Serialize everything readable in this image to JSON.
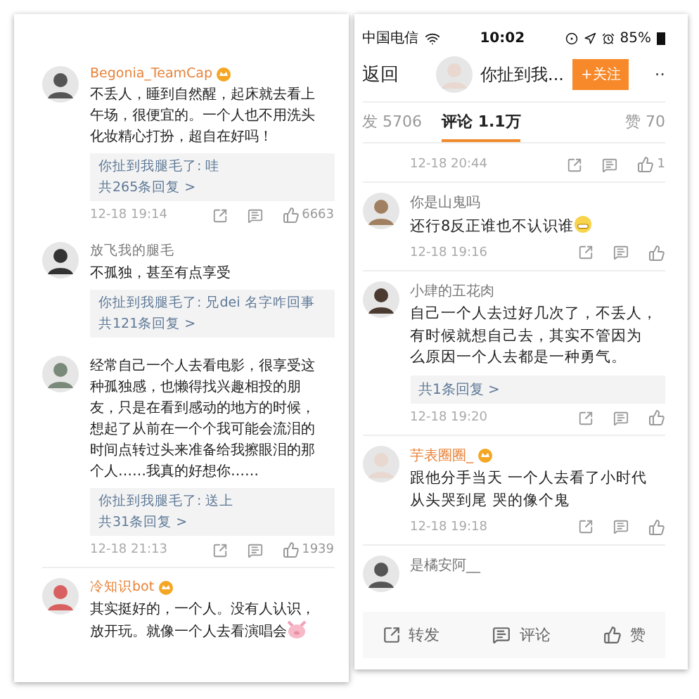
{
  "left_panel": {
    "comments": [
      {
        "kind": "comment",
        "user": "Begonia_TeamCap",
        "vip": true,
        "lines": [
          "不丢人，睡到自然醒，起床就去看上",
          "午场，很便宜的。一个人也不用洗头",
          "化妆精心打扮，超自在好吗！"
        ],
        "reply": {
          "preview": "你扯到我腿毛了: 哇",
          "count": "共265条回复 >"
        },
        "time": "12-18 19:14",
        "likes": "6663"
      },
      {
        "kind": "comment",
        "user": "放飞我的腿毛",
        "vip": false,
        "lines": [
          "不孤独，甚至有点享受"
        ],
        "reply": {
          "preview": "你扯到我腿毛了: 兄dei 名字咋回事",
          "count": "共121条回复 >"
        }
      },
      {
        "kind": "comment",
        "lines": [
          "经常自己一个人去看电影，很享受这",
          "种孤独感，也懒得找兴趣相投的朋",
          "友，只是在看到感动的地方的时候，",
          "想起了从前在一个个我可能会流泪的",
          "时间点转过头来准备给我擦眼泪的那",
          "个人……我真的好想你……"
        ],
        "reply": {
          "preview": "你扯到我腿毛了: 送上",
          "count": "共31条回复 >"
        },
        "time": "12-18 21:13",
        "likes": "1939"
      },
      {
        "kind": "comment",
        "user": "冷知识bot",
        "vip": true,
        "lines": [
          "其实挺好的，一个人。没有人认识，",
          "放开玩。就像一个人去看演唱会"
        ],
        "emoji": {
          "kind": "pig"
        }
      }
    ]
  },
  "right_panel": {
    "status_bar": {
      "carrier": "中国电信",
      "time": "10:02",
      "battery": "85%"
    },
    "nav": {
      "back": "返回",
      "title": "你扯到我...",
      "follow": "+关注",
      "more": "··"
    },
    "tabs": [
      {
        "label": "发 5706",
        "selected": false
      },
      {
        "label": "评论 1.1万",
        "selected": true
      },
      {
        "label": "赞 70",
        "selected": false
      }
    ],
    "comments": [
      {
        "kind": "footer",
        "time": "12-18 20:44",
        "likes": "1"
      },
      {
        "kind": "comment",
        "user": "你是山鬼吗",
        "vip": false,
        "lines": [
          "还行8反正谁也不认识谁"
        ],
        "emoji": {
          "kind": "grin"
        },
        "time": "12-18 19:16"
      },
      {
        "kind": "comment",
        "user": "小肆的五花肉",
        "vip": false,
        "lines": [
          "自己一个人去过好几次了，不丢人，",
          "有时候就想自己去，其实不管因为",
          "么原因一个人去都是一种勇气。"
        ],
        "reply": {
          "count": "共1条回复 >"
        },
        "time": "12-18 19:20"
      },
      {
        "kind": "comment",
        "user": "芋表圈圈_",
        "vip": true,
        "lines": [
          "跟他分手当天 一个人去看了小时代",
          "从头哭到尾 哭的像个鬼"
        ],
        "time": "12-18 19:18"
      },
      {
        "kind": "comment",
        "user": "是橘安阿__",
        "vip": false
      }
    ],
    "actions": [
      {
        "kind": "share",
        "label": "转发"
      },
      {
        "kind": "comment",
        "label": "评论"
      },
      {
        "kind": "like",
        "label": "赞"
      }
    ]
  }
}
